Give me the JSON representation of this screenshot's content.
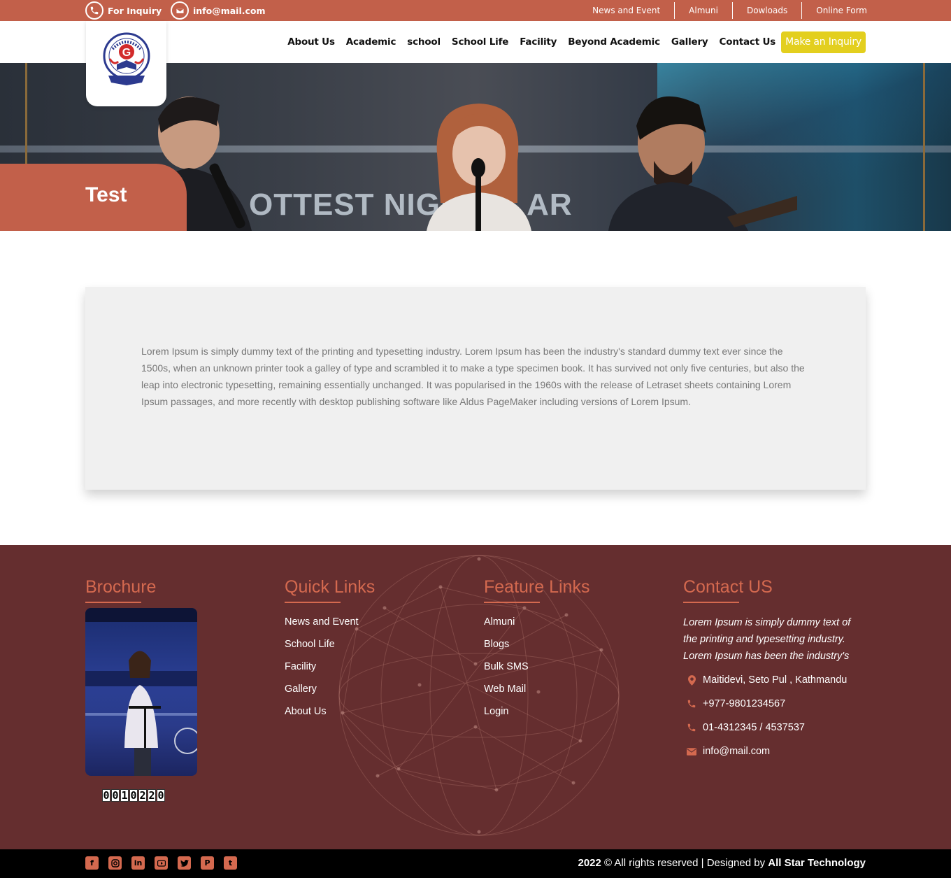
{
  "topbar": {
    "inquiry_label": "For Inquiry",
    "email": "info@mail.com",
    "links": [
      "News and Event",
      "Almuni",
      "Dowloads",
      "Online Form"
    ]
  },
  "nav": {
    "items": [
      "About Us",
      "Academic",
      "school",
      "School Life",
      "Facility",
      "Beyond Academic",
      "Gallery",
      "Contact Us"
    ],
    "cta": "Make an Inquiry"
  },
  "hero": {
    "title": "Test",
    "background_text": "OTTEST NIGH  UB AR"
  },
  "content": {
    "paragraph": "Lorem Ipsum is simply dummy text of the printing and typesetting industry. Lorem Ipsum has been the industry's standard dummy text ever since the 1500s, when an unknown printer took a galley of type and scrambled it to make a type specimen book. It has survived not only five centuries, but also the leap into electronic typesetting, remaining essentially unchanged. It was popularised in the 1960s with the release of Letraset sheets containing Lorem Ipsum passages, and more recently with desktop publishing software like Aldus PageMaker including versions of Lorem Ipsum."
  },
  "footer": {
    "brochure": {
      "heading": "Brochure",
      "counter": [
        "0",
        "0",
        "1",
        "0",
        "2",
        "2",
        "0"
      ]
    },
    "quick_links": {
      "heading": "Quick Links",
      "items": [
        "News and Event",
        "School Life",
        "Facility",
        "Gallery",
        "About Us"
      ]
    },
    "feature_links": {
      "heading": "Feature Links",
      "items": [
        "Almuni",
        "Blogs",
        "Bulk SMS",
        "Web Mail",
        "Login"
      ]
    },
    "contact": {
      "heading": "Contact US",
      "description": "Lorem Ipsum is simply dummy text of the printing and typesetting industry. Lorem Ipsum has been the industry's",
      "address": "Maitidevi, Seto Pul , Kathmandu",
      "mobile": "+977-9801234567",
      "phone": "01-4312345 / 4537537",
      "email": "info@mail.com"
    }
  },
  "bottom": {
    "year": "2022",
    "rights": " © All rights reserved | Designed by ",
    "designer": "All Star Technology",
    "social_icons": [
      "facebook-icon",
      "instagram-icon",
      "linkedin-icon",
      "youtube-icon",
      "twitter-icon",
      "pinterest-icon",
      "tumblr-icon"
    ]
  },
  "colors": {
    "brand": "#c2604a",
    "footer_bg": "#652e2f",
    "footer_accent": "#d4694f",
    "cta": "#e3cf1e"
  }
}
